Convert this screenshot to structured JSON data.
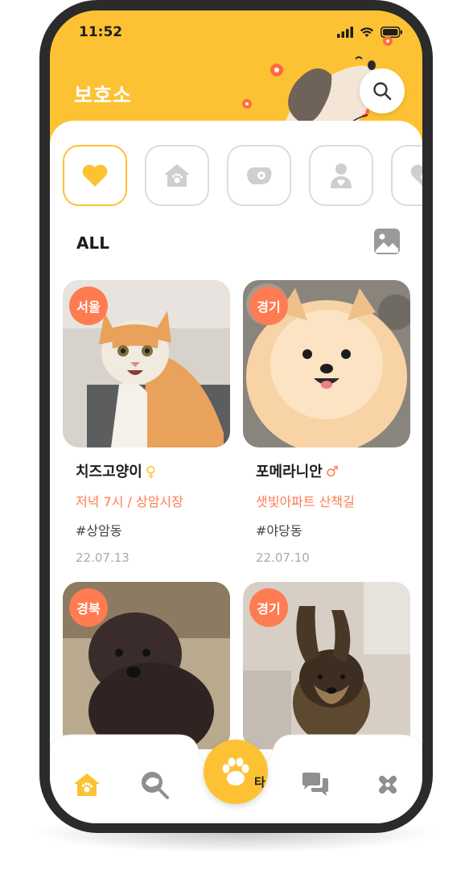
{
  "status_bar": {
    "time": "11:52"
  },
  "header": {
    "title": "보호소"
  },
  "filter": {
    "label": "ALL"
  },
  "categories": [
    {
      "icon": "heart-icon",
      "active": true
    },
    {
      "icon": "shelter-house-icon",
      "active": false
    },
    {
      "icon": "dog-tag-icon",
      "active": false
    },
    {
      "icon": "person-heart-icon",
      "active": false
    },
    {
      "icon": "heart-paw-icon",
      "active": false
    }
  ],
  "posts": [
    {
      "region": "서울",
      "name": "치즈고양이",
      "sex": "♀",
      "sex_color": "#fdc233",
      "location": "저녁 7시 / 상암시장",
      "tag": "#상암동",
      "date": "22.07.13"
    },
    {
      "region": "경기",
      "name": "포메라니안",
      "sex": "♂",
      "sex_color": "#ff7b52",
      "location": "샛빛아파트 산책길",
      "tag": "#야당동",
      "date": "22.07.10"
    },
    {
      "region": "경북",
      "name": "",
      "sex": "",
      "sex_color": "#fdc233",
      "location": "",
      "tag": "",
      "date": ""
    },
    {
      "region": "경기",
      "name": "",
      "sex": "",
      "sex_color": "#fdc233",
      "location": "",
      "tag": "",
      "date": ""
    }
  ],
  "tabbar": {
    "fab_label_fragment": "타",
    "tabs": [
      "home-icon",
      "search-dog-icon",
      "paw-icon",
      "chat-icon",
      "medical-icon"
    ]
  },
  "colors": {
    "accent": "#fdc233",
    "highlight": "#ff7b52",
    "text": "#1d1d1d"
  }
}
